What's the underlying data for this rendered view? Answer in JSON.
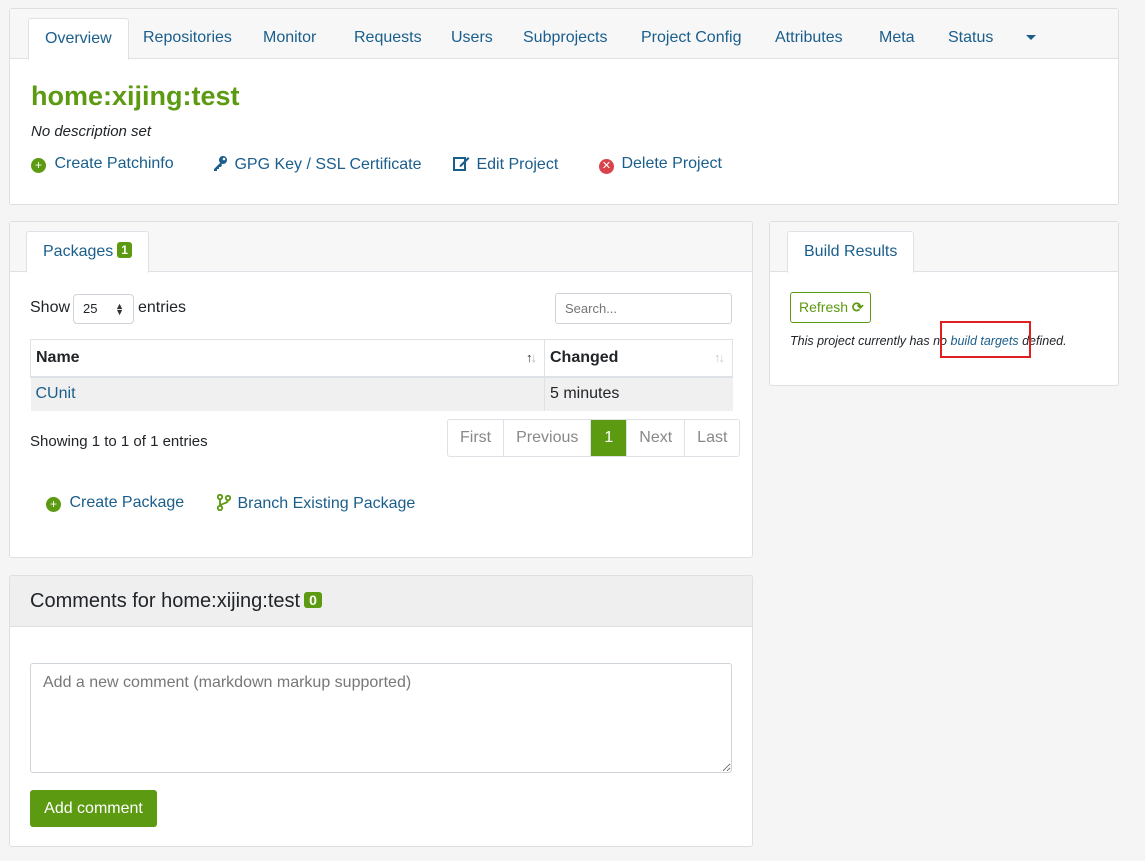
{
  "tabs": [
    {
      "label": "Overview",
      "active": true
    },
    {
      "label": "Repositories"
    },
    {
      "label": "Monitor"
    },
    {
      "label": "Requests"
    },
    {
      "label": "Users"
    },
    {
      "label": "Subprojects"
    },
    {
      "label": "Project Config"
    },
    {
      "label": "Attributes"
    },
    {
      "label": "Meta"
    },
    {
      "label": "Status"
    }
  ],
  "project": {
    "title": "home:xijing:test",
    "description": "No description set",
    "actions": {
      "create_patchinfo": "Create Patchinfo",
      "gpg_key": "GPG Key / SSL Certificate",
      "edit_project": "Edit Project",
      "delete_project": "Delete Project"
    }
  },
  "packages": {
    "tab_label": "Packages",
    "count": "1",
    "show_label": "Show",
    "entries_per_page": "25",
    "entries_label": "entries",
    "search_placeholder": "Search...",
    "columns": [
      "Name",
      "Changed"
    ],
    "rows": [
      {
        "name": "CUnit",
        "changed": "5 minutes"
      }
    ],
    "info": "Showing 1 to 1 of 1 entries",
    "pager": {
      "first": "First",
      "previous": "Previous",
      "current": "1",
      "next": "Next",
      "last": "Last"
    },
    "create_package": "Create Package",
    "branch_package": "Branch Existing Package"
  },
  "build_results": {
    "tab_label": "Build Results",
    "refresh": "Refresh",
    "note_prefix": "This project currently has no",
    "note_link": "build targets",
    "note_suffix": "defined."
  },
  "comments": {
    "title": "Comments for home:xijing:test",
    "count": "0",
    "placeholder": "Add a new comment (markdown markup supported)",
    "add_button": "Add comment"
  },
  "colors": {
    "accent_green": "#5c9a12",
    "link_blue": "#1a5e8c",
    "delete_red": "#d9434b",
    "highlight_red": "#e02020"
  }
}
